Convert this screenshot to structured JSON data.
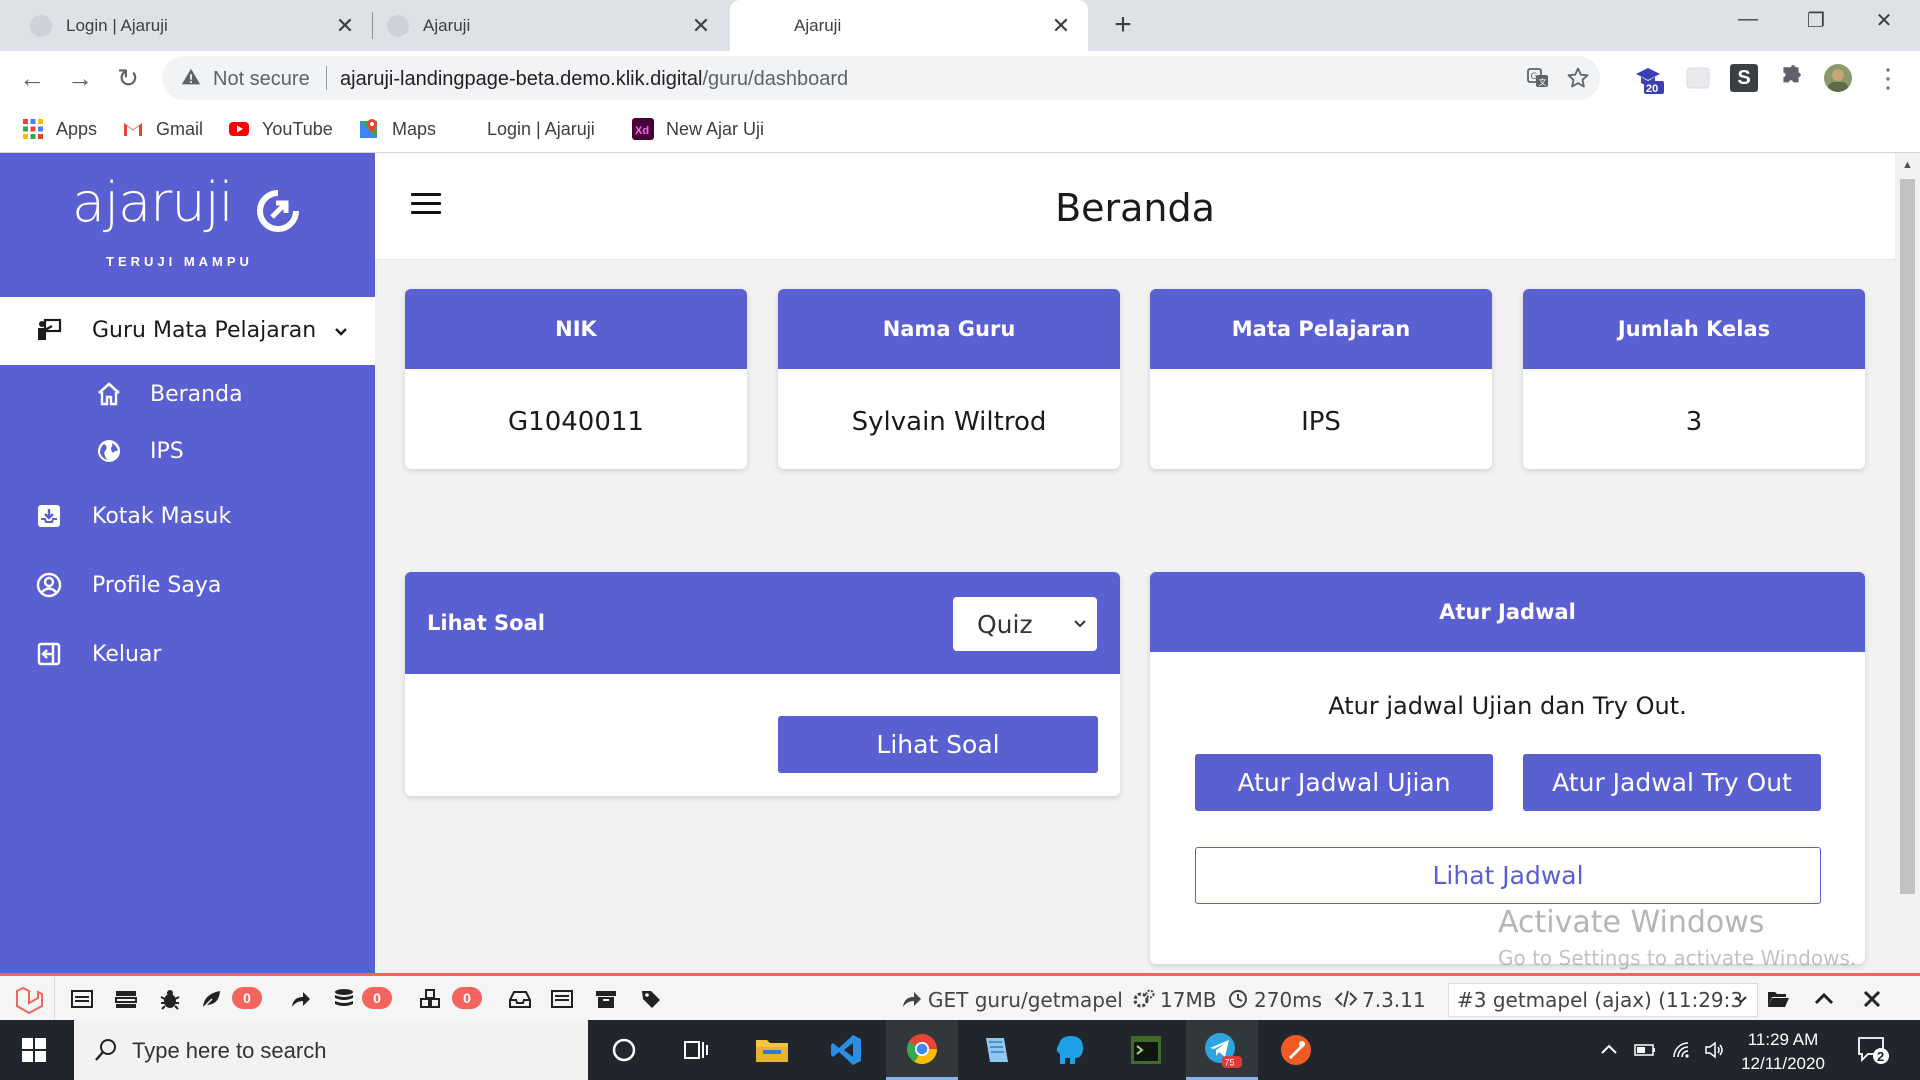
{
  "browser": {
    "tabs": [
      {
        "title": "Login | Ajaruji",
        "active": false
      },
      {
        "title": "Ajaruji",
        "active": false
      },
      {
        "title": "Ajaruji",
        "active": true
      }
    ],
    "close_glyph": "✕",
    "new_tab_glyph": "+",
    "window_controls": {
      "minimize": "—",
      "restore": "❐",
      "close": "✕"
    },
    "nav": {
      "back": "←",
      "forward": "→",
      "reload": "↻"
    },
    "security_label": "Not secure",
    "url_host": "ajaruji-landingpage-beta.demo.klik.digital",
    "url_path": "/guru/dashboard",
    "extension_badge": "20",
    "extension_letter": "S",
    "menu_glyph": "⋮",
    "bookmarks": [
      {
        "label": "Apps",
        "icon": "apps-grid-icon"
      },
      {
        "label": "Gmail",
        "icon": "gmail-icon"
      },
      {
        "label": "YouTube",
        "icon": "youtube-icon"
      },
      {
        "label": "Maps",
        "icon": "maps-icon"
      },
      {
        "label": "Login | Ajaruji",
        "icon": "ajaruji-favicon"
      },
      {
        "label": "New Ajar Uji",
        "icon": "xd-icon"
      }
    ]
  },
  "app": {
    "logo_text": "ajaruji",
    "logo_tagline": "TERUJI MAMPU",
    "accent_color": "#5a5fd2",
    "sidebar": {
      "group_label": "Guru Mata Pelajaran",
      "sub_items": [
        {
          "label": "Beranda",
          "icon": "home-icon"
        },
        {
          "label": "IPS",
          "icon": "globe-icon"
        }
      ],
      "items": [
        {
          "label": "Kotak Masuk",
          "icon": "inbox-icon"
        },
        {
          "label": "Profile Saya",
          "icon": "user-circle-icon"
        },
        {
          "label": "Keluar",
          "icon": "logout-icon"
        }
      ]
    },
    "page_title": "Beranda",
    "info_cards": [
      {
        "label": "NIK",
        "value": "G1040011"
      },
      {
        "label": "Nama Guru",
        "value": "Sylvain Wiltrod"
      },
      {
        "label": "Mata Pelajaran",
        "value": "IPS"
      },
      {
        "label": "Jumlah Kelas",
        "value": "3"
      }
    ],
    "lihat_soal": {
      "title": "Lihat Soal",
      "select_value": "Quiz",
      "button": "Lihat Soal"
    },
    "atur_jadwal": {
      "title": "Atur Jadwal",
      "description": "Atur jadwal Ujian dan Try Out.",
      "button_ujian": "Atur Jadwal Ujian",
      "button_tryout": "Atur Jadwal Try Out",
      "button_lihat": "Lihat Jadwal"
    },
    "watermark": {
      "line1": "Activate Windows",
      "line2": "Go to Settings to activate Windows."
    }
  },
  "debugbar": {
    "badges": [
      "0",
      "0",
      "0"
    ],
    "request": "GET guru/getmapel",
    "memory": "17MB",
    "time": "270ms",
    "php_version": "7.3.11",
    "selected_request": "#3 getmapel (ajax) (11:29:3"
  },
  "taskbar": {
    "search_placeholder": "Type here to search",
    "time": "11:29 AM",
    "date": "12/11/2020",
    "notification_count": "2",
    "telegram_badge": "75"
  }
}
